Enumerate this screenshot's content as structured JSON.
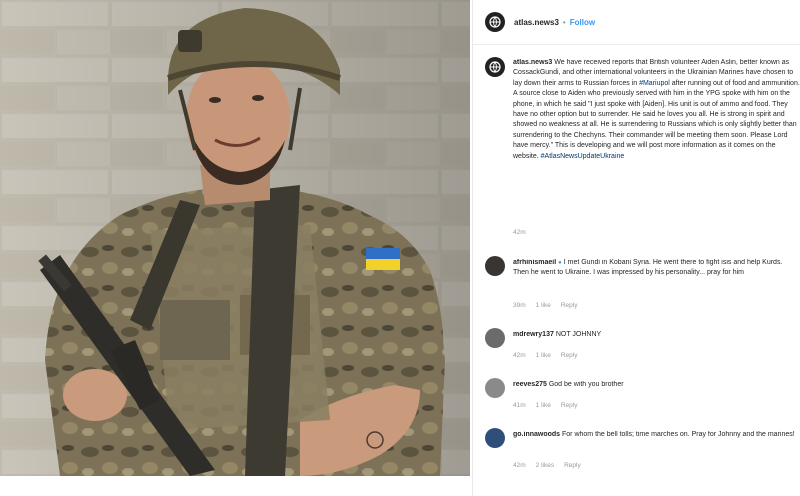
{
  "header": {
    "username": "atlas.news3",
    "separator": "•",
    "follow_label": "Follow"
  },
  "caption": {
    "username": "atlas.news3",
    "text": "We have received reports that British volunteer Aiden Aslin, better known as CossackGundi, and other international volunteers in the Ukrainian Marines have chosen to lay down their arms to Russian forces in",
    "hashtag1": "#Mariupol",
    "text2": "after running out of food and ammunition. A source close to Aiden who previously served with him in the YPG spoke with him on the phone, in which he said \"I just spoke with [Aiden]. His unit is out of ammo and food. They have no other option but to surrender. He said he loves you all. He is strong in spirit and showed no weakness at all. He is surrendering to Russians which is only slightly better than surrendering to the Chechyns. Their commander will be meeting them soon. Please Lord have mercy.\" This is developing and we will post more information as it comes on the website.",
    "hashtag2": "#AtlasNewsUpdateUkraine",
    "age": "42m"
  },
  "comments": [
    {
      "username": "afrhinismaeil",
      "verified_mark": "●",
      "text": "I met Gundi in Kobani Syria. He went there to fight isis and help Kurds. Then he went to Ukraine. I was impressed by his personality... pray for him",
      "age": "39m",
      "likes": "1 like",
      "reply": "Reply",
      "avatar_color": "#3a3530"
    },
    {
      "username": "mdrewry137",
      "text": "NOT JOHNNY",
      "age": "42m",
      "likes": "1 like",
      "reply": "Reply",
      "avatar_color": "#6b6b6b"
    },
    {
      "username": "reeves275",
      "text": "God be with you brother",
      "age": "41m",
      "likes": "1 like",
      "reply": "Reply",
      "avatar_color": "#8a8a8a"
    },
    {
      "username": "go.innawoods",
      "text": "For whom the bell tolls; time marches on. Pray for Johnny and the marines!",
      "age": "42m",
      "likes": "2 likes",
      "reply": "Reply",
      "avatar_color": "#2f4f7a"
    }
  ]
}
